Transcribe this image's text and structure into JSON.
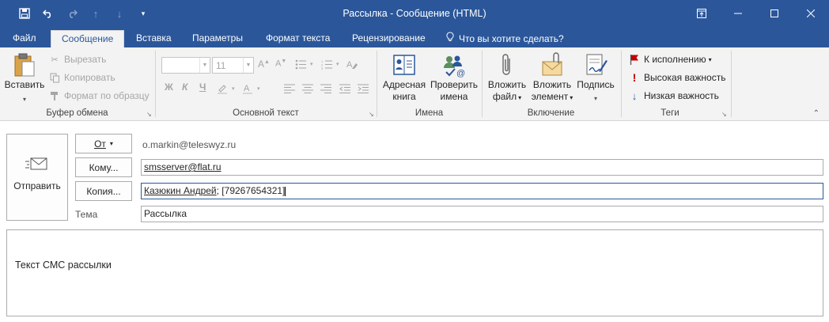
{
  "window": {
    "title": "Рассылка - Сообщение (HTML)"
  },
  "quick_access": {
    "icons": [
      "save-icon",
      "undo-icon",
      "redo-icon",
      "up-arrow-icon",
      "down-arrow-icon",
      "customize-qat-icon"
    ]
  },
  "tabs": [
    {
      "label": "Файл"
    },
    {
      "label": "Сообщение"
    },
    {
      "label": "Вставка"
    },
    {
      "label": "Параметры"
    },
    {
      "label": "Формат текста"
    },
    {
      "label": "Рецензирование"
    }
  ],
  "tell_me": {
    "label": "Что вы хотите сделать?"
  },
  "ribbon": {
    "clipboard": {
      "paste": "Вставить",
      "cut": "Вырезать",
      "copy": "Копировать",
      "format_painter": "Формат по образцу",
      "group_label": "Буфер обмена"
    },
    "basic_text": {
      "font_name": "",
      "font_size": "11",
      "bold": "Ж",
      "italic": "К",
      "underline": "Ч",
      "group_label": "Основной текст"
    },
    "names": {
      "address_book_line1": "Адресная",
      "address_book_line2": "книга",
      "check_names_line1": "Проверить",
      "check_names_line2": "имена",
      "group_label": "Имена"
    },
    "include": {
      "attach_file_line1": "Вложить",
      "attach_file_line2": "файл",
      "attach_item_line1": "Вложить",
      "attach_item_line2": "элемент",
      "signature_line1": "Подпись",
      "group_label": "Включение"
    },
    "tags": {
      "follow_up": "К исполнению",
      "high_importance": "Высокая важность",
      "low_importance": "Низкая важность",
      "group_label": "Теги"
    }
  },
  "message": {
    "send_label": "Отправить",
    "from_label": "От",
    "from_value": "o.markin@teleswyz.ru",
    "to_label": "Кому...",
    "to_value": "smsserver@flat.ru",
    "cc_label": "Копия...",
    "cc_name": "Казюкин Андрей",
    "cc_rest": "; [79267654321]",
    "subject_label": "Тема",
    "subject_value": "Рассылка",
    "body_text": "Текст СМС рассылки"
  },
  "colors": {
    "accent": "#2b579a",
    "ribbon_bg": "#f3f3f3",
    "high_importance": "#c00000",
    "low_importance": "#2b579a",
    "flag": "#c00000"
  }
}
